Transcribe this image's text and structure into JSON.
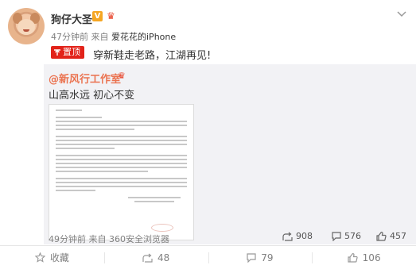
{
  "post": {
    "username": "狗仔大圣",
    "verified_badge": "V",
    "member_icon": "crown-icon",
    "meta": {
      "time": "47分钟前",
      "source_prefix": "来自",
      "source": "爱花花的iPhone"
    },
    "tag_label": "置顶",
    "text": "穿新鞋走老路，江湖再见!"
  },
  "repost": {
    "username": "@新风行工作室",
    "text": "山高水远 初心不变",
    "footer": {
      "time": "49分钟前",
      "source_prefix": "来自",
      "source": "360安全浏览器"
    },
    "stats": {
      "shares": "908",
      "comments": "576",
      "likes": "457"
    }
  },
  "actions": {
    "collect": "收藏",
    "share": "48",
    "comment": "79",
    "like": "106"
  },
  "colors": {
    "accent": "#eb7350",
    "tag_red": "#e2231a",
    "badge_gold": "#f5a623"
  }
}
